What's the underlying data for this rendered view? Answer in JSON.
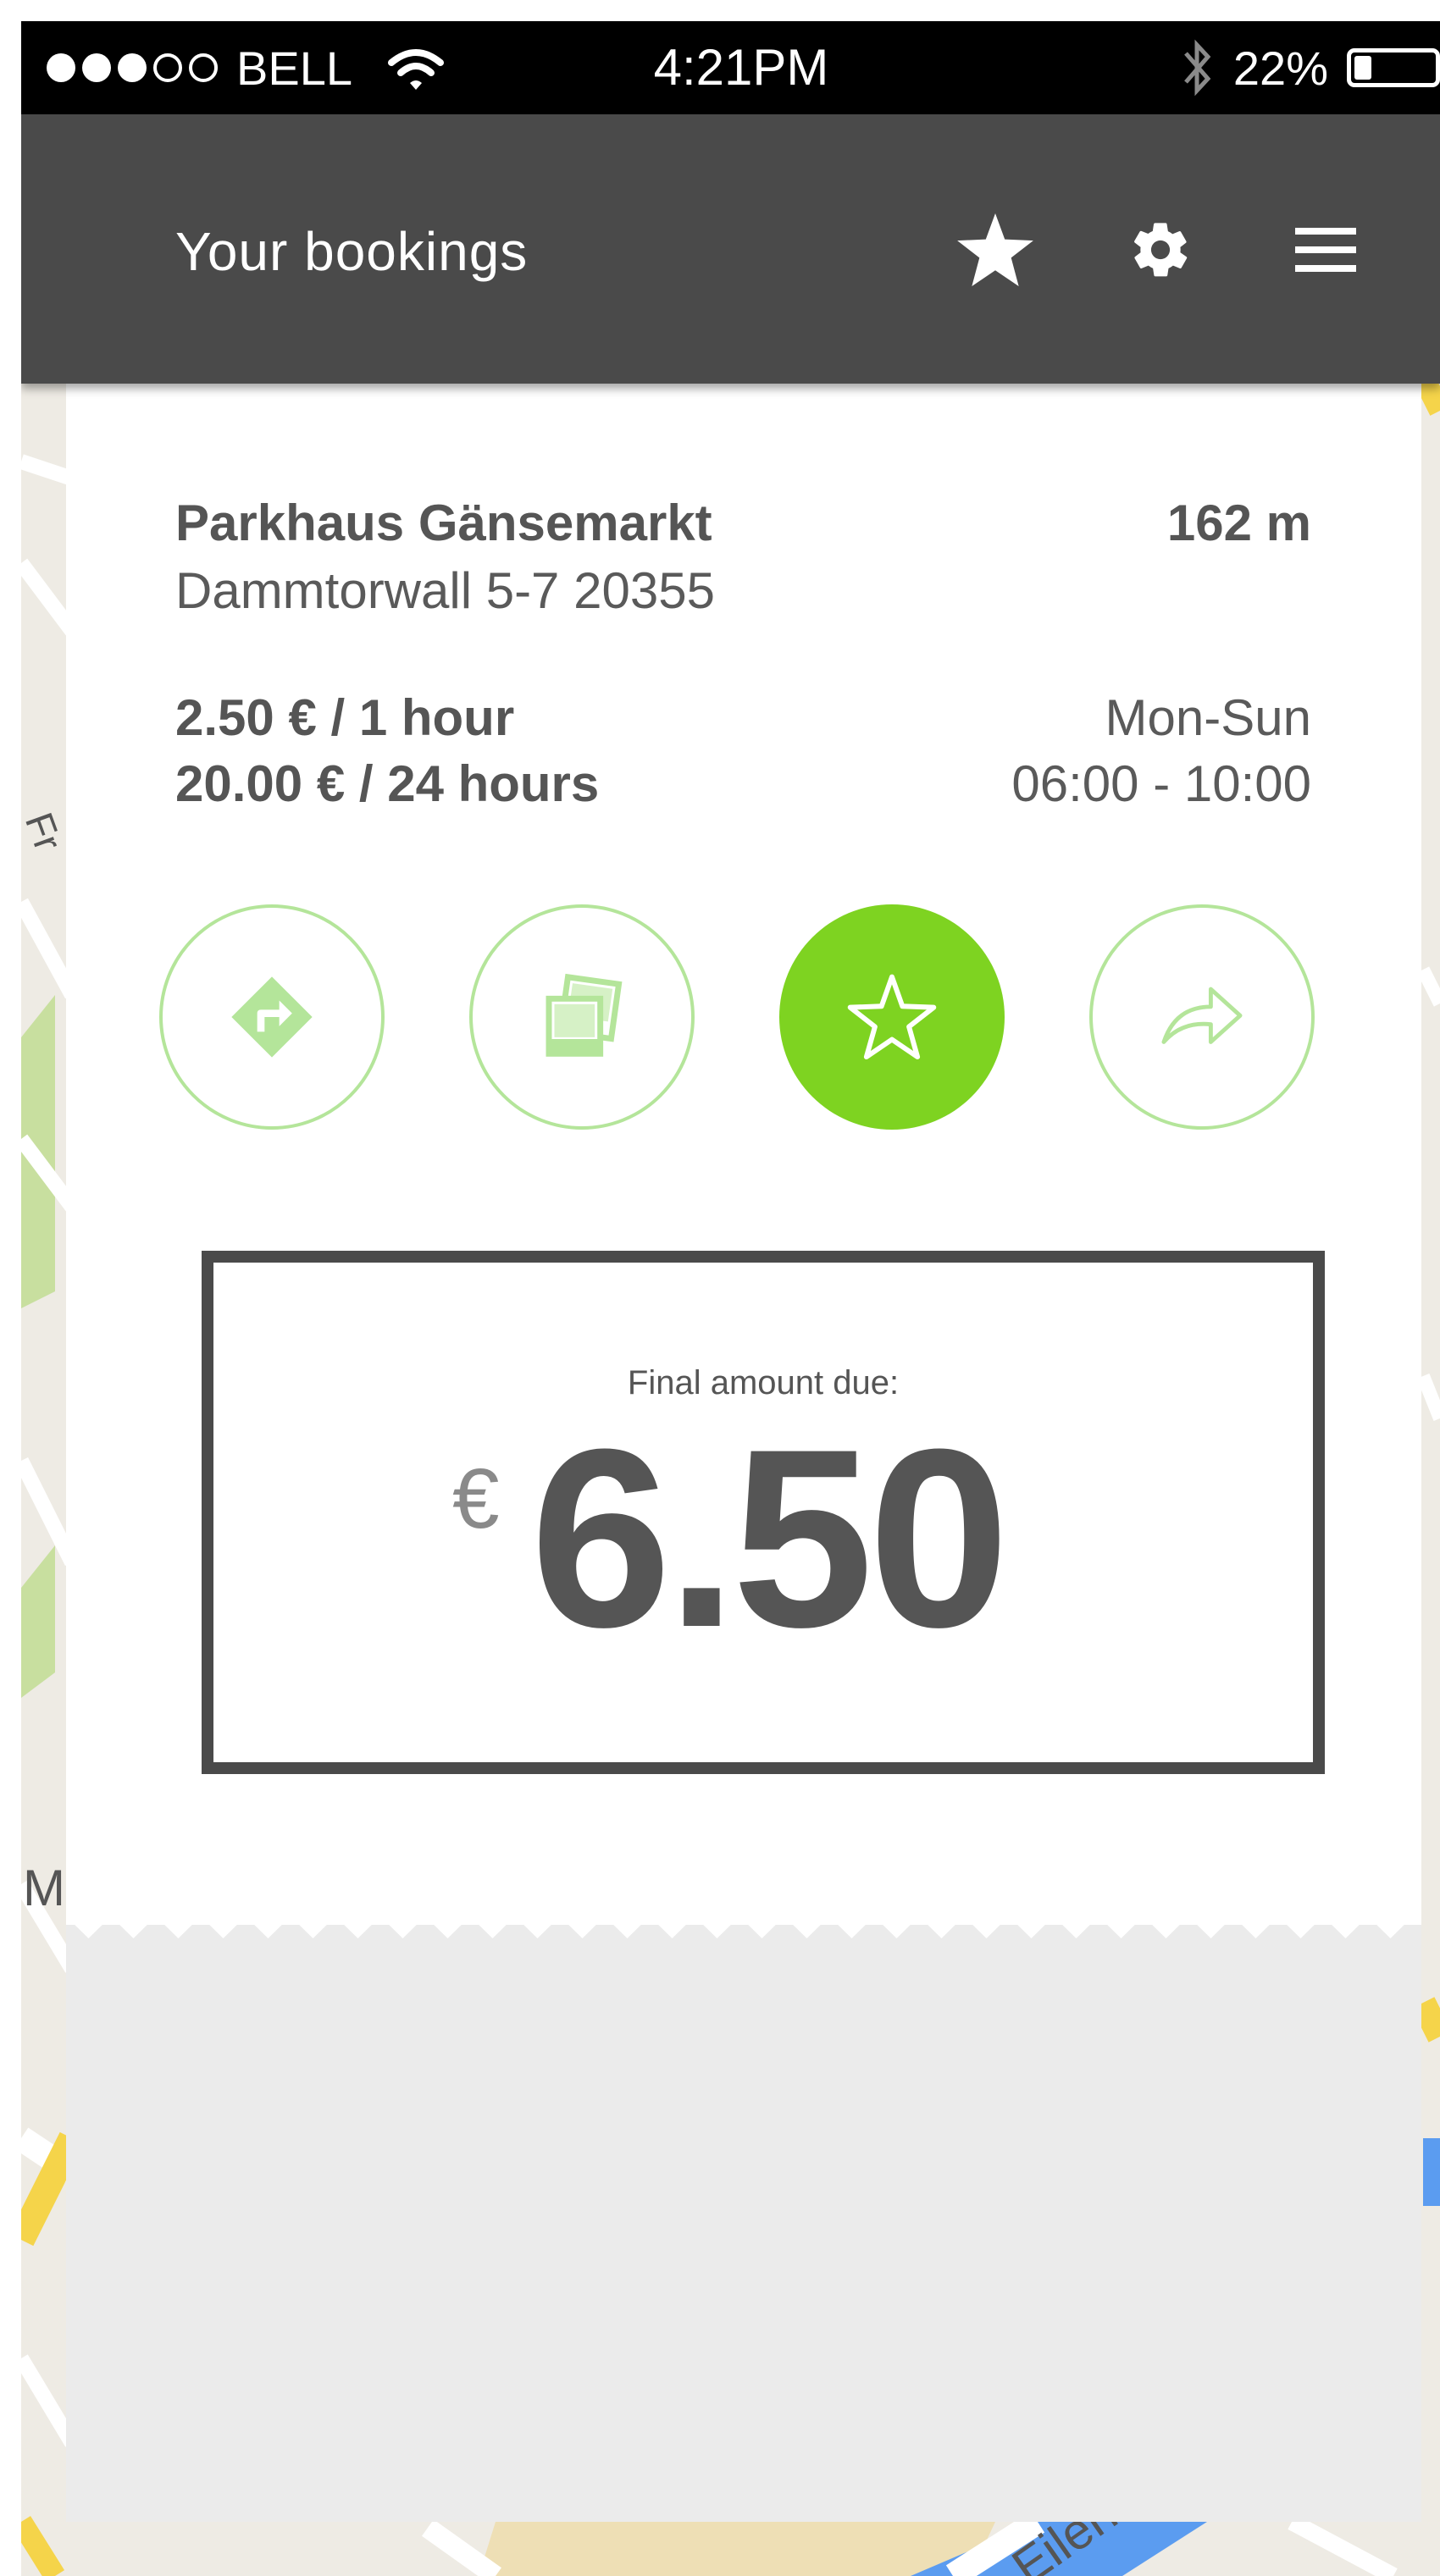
{
  "status_bar": {
    "carrier": "BELL",
    "time": "4:21PM",
    "battery_percent": "22%",
    "battery_level": 0.22,
    "signal_bars_filled": 3,
    "signal_bars_total": 5
  },
  "header": {
    "title": "Your bookings",
    "icons": [
      "star-icon",
      "gear-icon",
      "menu-icon"
    ]
  },
  "garage": {
    "name": "Parkhaus Gänsemarkt",
    "address": "Dammtorwall 5-7 20355",
    "distance": "162 m",
    "price_hour": "2.50 € / 1 hour",
    "price_day": "20.00 € / 24 hours",
    "days": "Mon-Sun",
    "hours": "06:00 - 10:00"
  },
  "actions": [
    {
      "name": "directions",
      "icon": "directions-icon",
      "active": false
    },
    {
      "name": "photos",
      "icon": "photos-icon",
      "active": false
    },
    {
      "name": "favorite",
      "icon": "star-outline-icon",
      "active": true
    },
    {
      "name": "share",
      "icon": "share-icon",
      "active": false
    }
  ],
  "payment": {
    "label": "Final amount due:",
    "currency": "€",
    "amount": "6.50"
  },
  "map": {
    "labels": [
      "Fr",
      "M",
      "Eilen"
    ]
  },
  "colors": {
    "accent": "#7ed321",
    "accent_light": "#b4e59a",
    "header_bg": "#4a4a4a",
    "text": "#555555"
  }
}
